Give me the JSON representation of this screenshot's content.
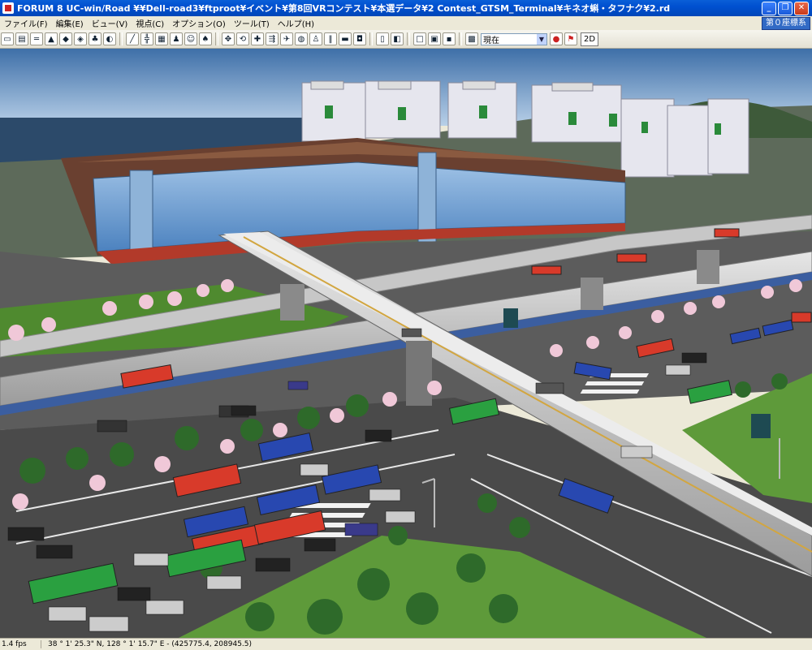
{
  "window": {
    "title": "FORUM 8    UC-win/Road    ¥¥Dell-road3¥ftproot¥イベント¥第8回VRコンテスト¥本選データ¥2 Contest_GTSM_Terminal¥キネオ蝌・タフナク¥2.rd"
  },
  "menu": {
    "items": [
      "ファイル(F)",
      "編集(E)",
      "ビュー(V)",
      "視点(C)",
      "オプション(O)",
      "ツール(T)",
      "ヘルプ(H)"
    ],
    "coord_label": "第０座標系"
  },
  "toolbar": {
    "mode_value": "現在",
    "view_2d_label": "2D",
    "icons": [
      "new-file-icon",
      "open-folder-icon",
      "road-icon",
      "terrain-icon",
      "object-icon",
      "model-icon",
      "tree-icon",
      "mask-icon",
      "draw-road-icon",
      "intersection-icon",
      "texture-icon",
      "person-icon",
      "walk-icon",
      "plant-icon",
      "navigate-icon",
      "rotate-icon",
      "move-icon",
      "drive-icon",
      "fly-icon",
      "globe-icon",
      "walk-mode-icon",
      "pause-icon",
      "car-icon",
      "vehicle-icon",
      "book-icon",
      "new-doc-icon",
      "open-doc-icon",
      "save-icon",
      "screen-icon"
    ]
  },
  "status": {
    "fps": "1.4 fps",
    "coordinates": "38 °  1' 25.3\" N, 128 °  1' 15.7\" E  -  (425775.4, 208945.5)"
  },
  "colors": {
    "title_bar": "#0050d0",
    "sky": "#8fb4d8",
    "sea": "#2c4a6a",
    "road": "#4a4a4a",
    "grass": "#5e9a3a",
    "bus_red": "#d83a2a",
    "bus_blue": "#2848b0",
    "bus_green": "#2aa040"
  }
}
